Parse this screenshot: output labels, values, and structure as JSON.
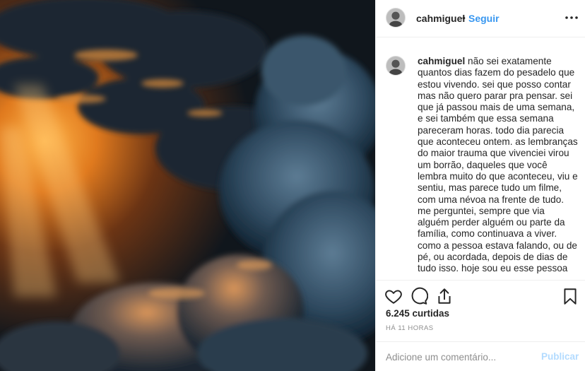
{
  "post": {
    "username": "cahmiguel",
    "dot": "•",
    "follow_label": "Seguir",
    "more_icon": "more-horizontal-icon"
  },
  "caption": {
    "username": "cahmiguel",
    "lines": [
      "não sei exatamente quantos dias fazem do pesadelo que estou vivendo. sei que posso contar mas não quero parar pra pensar. sei que já passou mais de uma semana, e sei também que essa semana pareceram horas. todo dia parecia que aconteceu ontem. as lembranças do maior trauma que vivenciei virou um borrão, daqueles que você lembra muito do que aconteceu, viu e sentiu, mas parece tudo um filme, com uma névoa na frente de tudo.",
      "me perguntei, sempre que via alguém perder alguém ou parte da família, como continuava a viver. como a pessoa estava falando, ou de pé, ou acordada, depois de dias de tudo isso. hoje sou eu esse pessoa"
    ]
  },
  "actions": {
    "like_icon": "heart-icon",
    "comment_icon": "comment-icon",
    "share_icon": "share-icon",
    "save_icon": "bookmark-icon"
  },
  "likes_text": "6.245 curtidas",
  "time_text": "HÁ 11 HORAS",
  "comment_box": {
    "placeholder": "Adicione um comentário...",
    "post_label": "Publicar"
  },
  "colors": {
    "link_blue": "#3897f0",
    "publish_disabled": "#b3dbff",
    "muted": "#8e8e8e",
    "border": "#efefef"
  }
}
